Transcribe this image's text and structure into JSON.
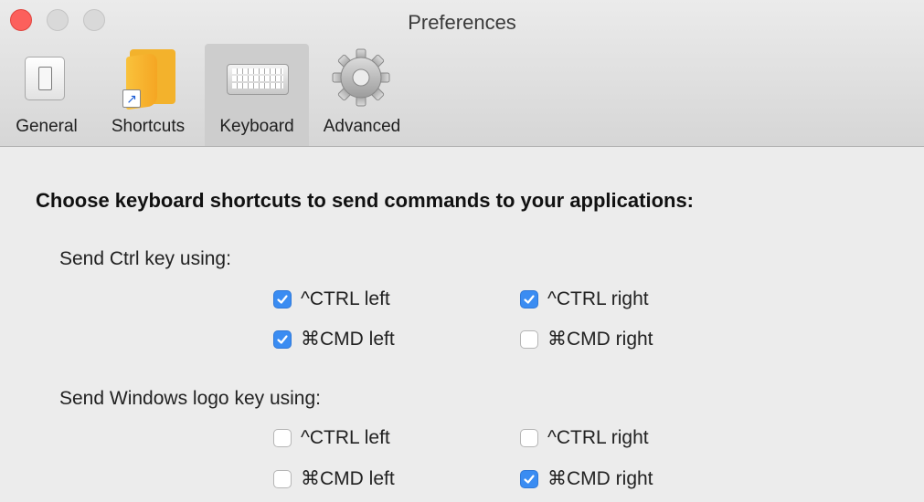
{
  "window": {
    "title": "Preferences"
  },
  "tabs": [
    {
      "label": "General",
      "icon": "light-switch-icon",
      "selected": false
    },
    {
      "label": "Shortcuts",
      "icon": "folder-alias-icon",
      "selected": false
    },
    {
      "label": "Keyboard",
      "icon": "keyboard-icon",
      "selected": true
    },
    {
      "label": "Advanced",
      "icon": "gear-icon",
      "selected": false
    }
  ],
  "content": {
    "heading": "Choose keyboard shortcuts to send commands to your applications:",
    "groups": [
      {
        "label": "Send Ctrl key using:",
        "options": [
          {
            "label": "^CTRL left",
            "checked": true
          },
          {
            "label": "^CTRL right",
            "checked": true
          },
          {
            "label": "⌘CMD left",
            "checked": true
          },
          {
            "label": "⌘CMD right",
            "checked": false
          }
        ]
      },
      {
        "label": "Send Windows logo key using:",
        "options": [
          {
            "label": "^CTRL left",
            "checked": false
          },
          {
            "label": "^CTRL right",
            "checked": false
          },
          {
            "label": "⌘CMD left",
            "checked": false
          },
          {
            "label": "⌘CMD right",
            "checked": true
          }
        ]
      }
    ]
  },
  "colors": {
    "accent": "#3a8cf2",
    "close_button": "#fc605c"
  }
}
